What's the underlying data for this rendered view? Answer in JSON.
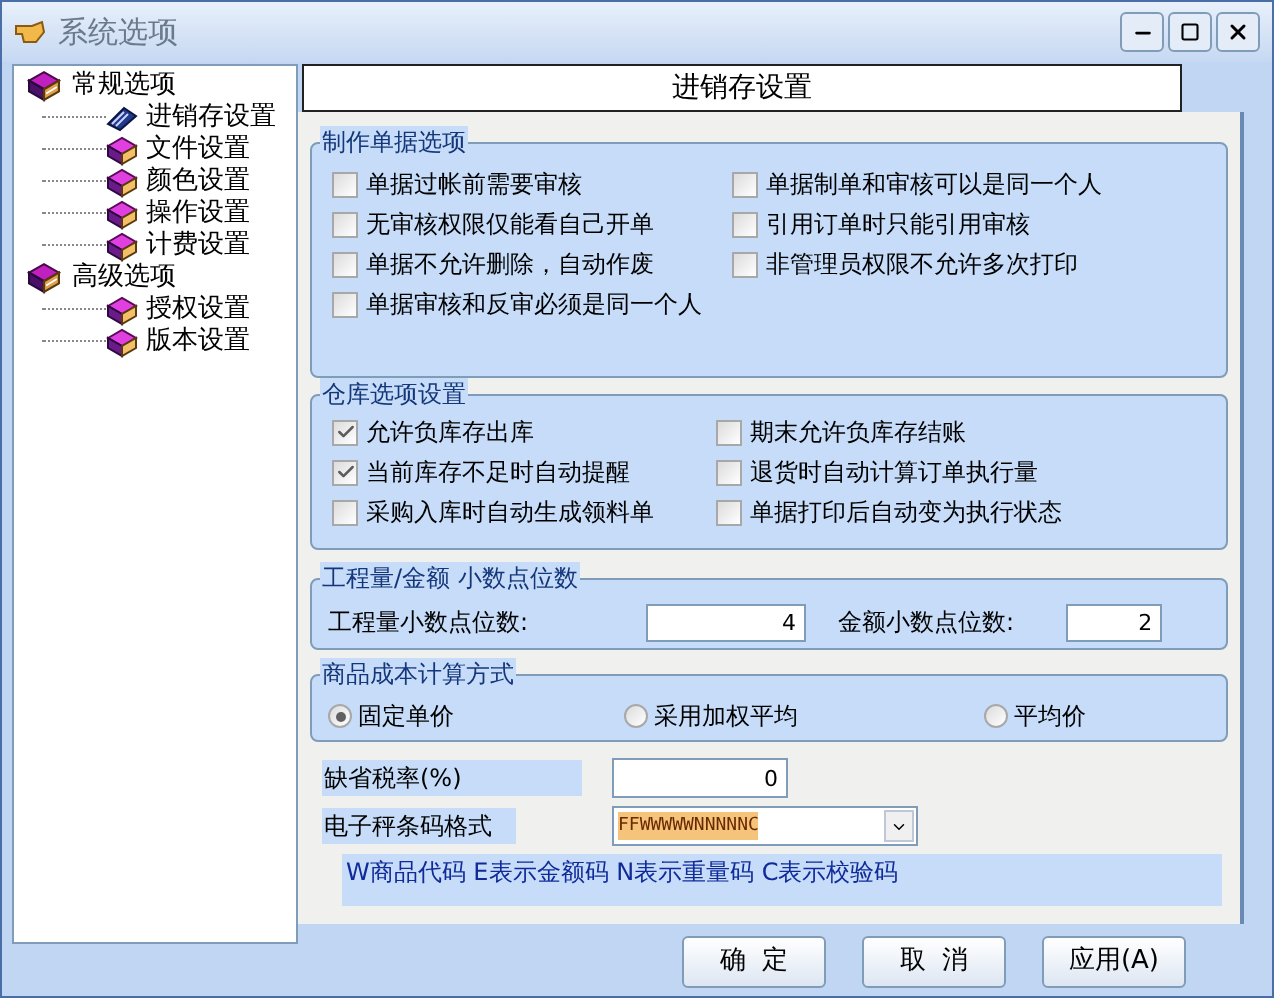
{
  "window": {
    "title": "系统选项"
  },
  "tree": [
    {
      "label": "常规选项",
      "kind": "folder",
      "children": [
        {
          "label": "进销存设置",
          "kind": "pen"
        },
        {
          "label": "文件设置",
          "kind": "book"
        },
        {
          "label": "颜色设置",
          "kind": "book"
        },
        {
          "label": "操作设置",
          "kind": "book"
        },
        {
          "label": "计费设置",
          "kind": "book"
        }
      ]
    },
    {
      "label": "高级选项",
      "kind": "folder",
      "children": [
        {
          "label": "授权设置",
          "kind": "book"
        },
        {
          "label": "版本设置",
          "kind": "book"
        }
      ]
    }
  ],
  "panel_title": "进销存设置",
  "document_options": {
    "title": "制作单据选项",
    "items": [
      {
        "label": "单据过帐前需要审核",
        "checked": false
      },
      {
        "label": "单据制单和审核可以是同一个人",
        "checked": false
      },
      {
        "label": "无审核权限仅能看自己开单",
        "checked": false
      },
      {
        "label": "引用订单时只能引用审核",
        "checked": false
      },
      {
        "label": "单据不允许删除，自动作废",
        "checked": false
      },
      {
        "label": "非管理员权限不允许多次打印",
        "checked": false
      },
      {
        "label": "单据审核和反审必须是同一个人",
        "checked": false
      }
    ]
  },
  "warehouse_options": {
    "title": "仓库选项设置",
    "items": [
      {
        "label": "允许负库存出库",
        "checked": true
      },
      {
        "label": "期末允许负库存结账",
        "checked": false
      },
      {
        "label": "当前库存不足时自动提醒",
        "checked": true
      },
      {
        "label": "退货时自动计算订单执行量",
        "checked": false
      },
      {
        "label": "采购入库时自动生成领料单",
        "checked": false
      },
      {
        "label": "单据打印后自动变为执行状态",
        "checked": false
      }
    ]
  },
  "decimals": {
    "title": "工程量/金额 小数点位数",
    "fields": [
      {
        "label": "工程量小数点位数:",
        "value": "4"
      },
      {
        "label": "金额小数点位数:",
        "value": "2"
      }
    ]
  },
  "cost_method": {
    "title": "商品成本计算方式",
    "options": [
      {
        "label": "固定单价",
        "selected": true
      },
      {
        "label": "采用加权平均",
        "selected": false
      },
      {
        "label": "平均价",
        "selected": false
      }
    ]
  },
  "tax": {
    "label": "缺省税率(%)",
    "value": "0"
  },
  "barcode": {
    "label": "电子秤条码格式",
    "value": "FFWWWWWNNNNNC",
    "hint": "W商品代码 E表示金额码 N表示重量码 C表示校验码"
  },
  "buttons": [
    "确  定",
    "取  消",
    "应用(A)"
  ]
}
